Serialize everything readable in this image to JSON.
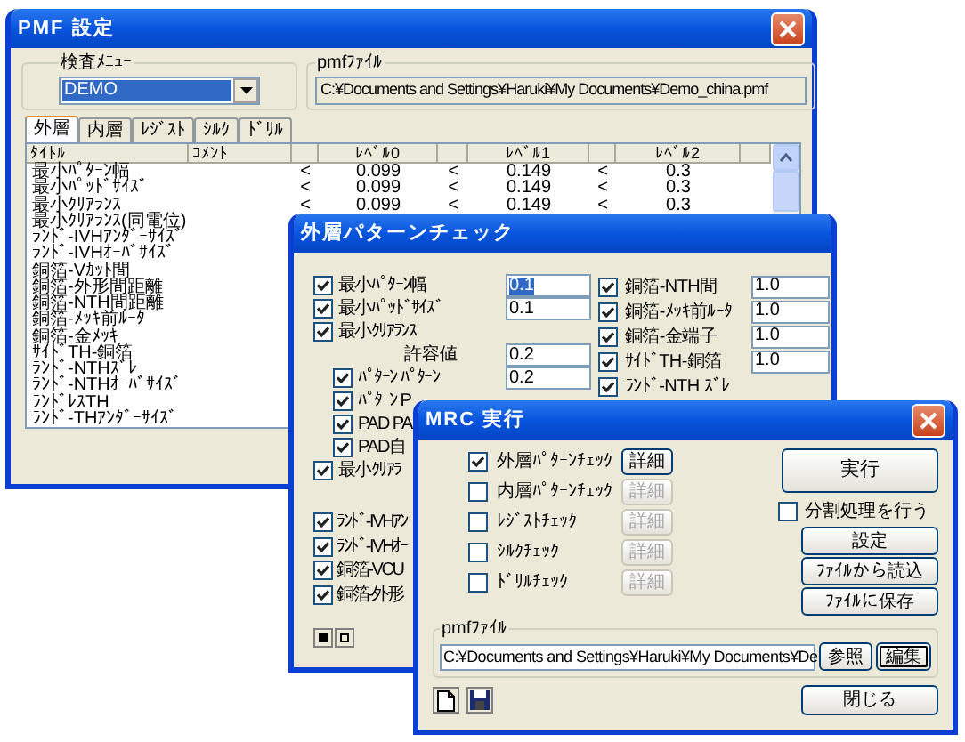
{
  "pmf_window": {
    "title": "PMF 設定",
    "menu_group": {
      "label": "検査ﾒﾆｭｰ",
      "value": "DEMO"
    },
    "file_group": {
      "label": "pmfﾌｧｲﾙ",
      "value": "C:¥Documents and Settings¥Haruki¥My Documents¥Demo_china.pmf"
    },
    "tabs": [
      {
        "label": "外層",
        "selected": true
      },
      {
        "label": "内層",
        "selected": false
      },
      {
        "label": "ﾚｼﾞｽﾄ",
        "selected": false
      },
      {
        "label": "ｼﾙｸ",
        "selected": false
      },
      {
        "label": "ﾄﾞﾘﾙ",
        "selected": false
      }
    ],
    "table": {
      "columns": [
        "ﾀｲﾄﾙ",
        "ｺﾒﾝﾄ",
        "ﾚﾍﾞﾙ0",
        "ﾚﾍﾞﾙ1",
        "ﾚﾍﾞﾙ2"
      ],
      "rows": [
        {
          "title": "最小ﾊﾟﾀｰﾝ幅",
          "cells": [
            "<",
            "0.099",
            "<",
            "0.149",
            "<",
            "0.3"
          ]
        },
        {
          "title": "最小ﾊﾟｯﾄﾞｻｲｽﾞ",
          "cells": [
            "<",
            "0.099",
            "<",
            "0.149",
            "<",
            "0.3"
          ]
        },
        {
          "title": "最小ｸﾘｱﾗﾝｽ",
          "cells": [
            "<",
            "0.099",
            "<",
            "0.149",
            "<",
            "0.3"
          ]
        },
        {
          "title": "最小ｸﾘｱﾗﾝｽ(同電位)"
        },
        {
          "title": "ﾗﾝﾄﾞ-IVHｱﾝﾀﾞｰｻｲｽﾞ"
        },
        {
          "title": "ﾗﾝﾄﾞ-IVHｵｰﾊﾞｻｲｽﾞ"
        },
        {
          "title": "銅箔-Vｶｯﾄ間"
        },
        {
          "title": "銅箔-外形間距離"
        },
        {
          "title": "銅箔-NTH間距離"
        },
        {
          "title": "銅箔-ﾒｯｷ前ﾙｰﾀ"
        },
        {
          "title": "銅箔-金ﾒｯｷ"
        },
        {
          "title": "ｻｲﾄﾞTH-銅箔"
        },
        {
          "title": "ﾗﾝﾄﾞ-NTHｽﾞﾚ"
        },
        {
          "title": "ﾗﾝﾄﾞ-NTHｵｰﾊﾞｻｲｽﾞ"
        },
        {
          "title": "ﾗﾝﾄﾞﾚｽTH"
        },
        {
          "title": "ﾗﾝﾄﾞ-THｱﾝﾀﾞｰｻｲｽﾞ"
        }
      ]
    }
  },
  "pattern_window": {
    "title": "外層パターンチェック",
    "left_items": [
      {
        "kind": "check",
        "label": "最小ﾊﾟﾀｰﾝ幅",
        "checked": true,
        "field": {
          "value": "0.1",
          "selected": true
        }
      },
      {
        "kind": "check",
        "label": "最小ﾊﾟｯﾄﾞｻｲｽﾞ",
        "checked": true,
        "field": {
          "value": "0.1",
          "selected": false
        }
      },
      {
        "kind": "check",
        "label": "最小ｸﾘｱﾗﾝｽ",
        "checked": true
      },
      {
        "kind": "caption",
        "label": "許容値",
        "field": {
          "value": "0.2",
          "selected": false
        }
      },
      {
        "kind": "sub",
        "label": "ﾊﾟﾀｰﾝ ﾊﾟﾀｰﾝ",
        "checked": true,
        "field": {
          "value": "0.2",
          "selected": false
        }
      },
      {
        "kind": "sub",
        "label": "ﾊﾟﾀｰﾝ P",
        "checked": true
      },
      {
        "kind": "sub",
        "label": "PAD PA",
        "checked": true
      },
      {
        "kind": "sub",
        "label": "PAD自",
        "checked": true
      },
      {
        "kind": "check",
        "label": "最小ｸﾘｱﾗ",
        "checked": true
      }
    ],
    "lower_items": [
      {
        "label": "ﾗﾝﾄﾞ-IVHｱﾝ",
        "checked": true
      },
      {
        "label": "ﾗﾝﾄﾞ-IVHｵｰ",
        "checked": true
      },
      {
        "label": "銅箔-VCU",
        "checked": true
      },
      {
        "label": "銅箔-外形",
        "checked": true
      }
    ],
    "right_items": [
      {
        "label": "銅箔-NTH間",
        "checked": true,
        "field": {
          "value": "1.0",
          "selected": false
        }
      },
      {
        "label": "銅箔-ﾒｯｷ前ﾙｰﾀ",
        "checked": true,
        "field": {
          "value": "1.0",
          "selected": false
        }
      },
      {
        "label": "銅箔-金端子",
        "checked": true,
        "field": {
          "value": "1.0",
          "selected": false
        }
      },
      {
        "label": "ｻｲﾄﾞTH-銅箔",
        "checked": true,
        "field": {
          "value": "1.0",
          "selected": false
        }
      },
      {
        "label": "ﾗﾝﾄﾞ-NTH ｽﾞﾚ",
        "checked": true
      }
    ]
  },
  "mrc_window": {
    "title": "MRC 実行",
    "checks": [
      {
        "label": "外層ﾊﾟﾀｰﾝﾁｪｯｸ",
        "checked": true,
        "detail": {
          "label": "詳細",
          "disabled": false
        }
      },
      {
        "label": "内層ﾊﾟﾀｰﾝﾁｪｯｸ",
        "checked": false,
        "detail": {
          "label": "詳細",
          "disabled": true
        }
      },
      {
        "label": "ﾚｼﾞｽﾄﾁｪｯｸ",
        "checked": false,
        "detail": {
          "label": "詳細",
          "disabled": true
        }
      },
      {
        "label": "ｼﾙｸﾁｪｯｸ",
        "checked": false,
        "detail": {
          "label": "詳細",
          "disabled": true
        }
      },
      {
        "label": "ﾄﾞﾘﾙﾁｪｯｸ",
        "checked": false,
        "detail": {
          "label": "詳細",
          "disabled": true
        }
      }
    ],
    "run_button": "実行",
    "split": {
      "label": "分割処理を行う",
      "checked": false
    },
    "buttons": [
      "設定",
      "ﾌｧｲﾙから読込",
      "ﾌｧｲﾙに保存"
    ],
    "file_group": {
      "label": "pmfﾌｧｲﾙ",
      "value": "C:¥Documents and Settings¥Haruki¥My Documents¥De",
      "browse": "参照",
      "edit": "編集"
    },
    "close_button": "閉じる"
  }
}
